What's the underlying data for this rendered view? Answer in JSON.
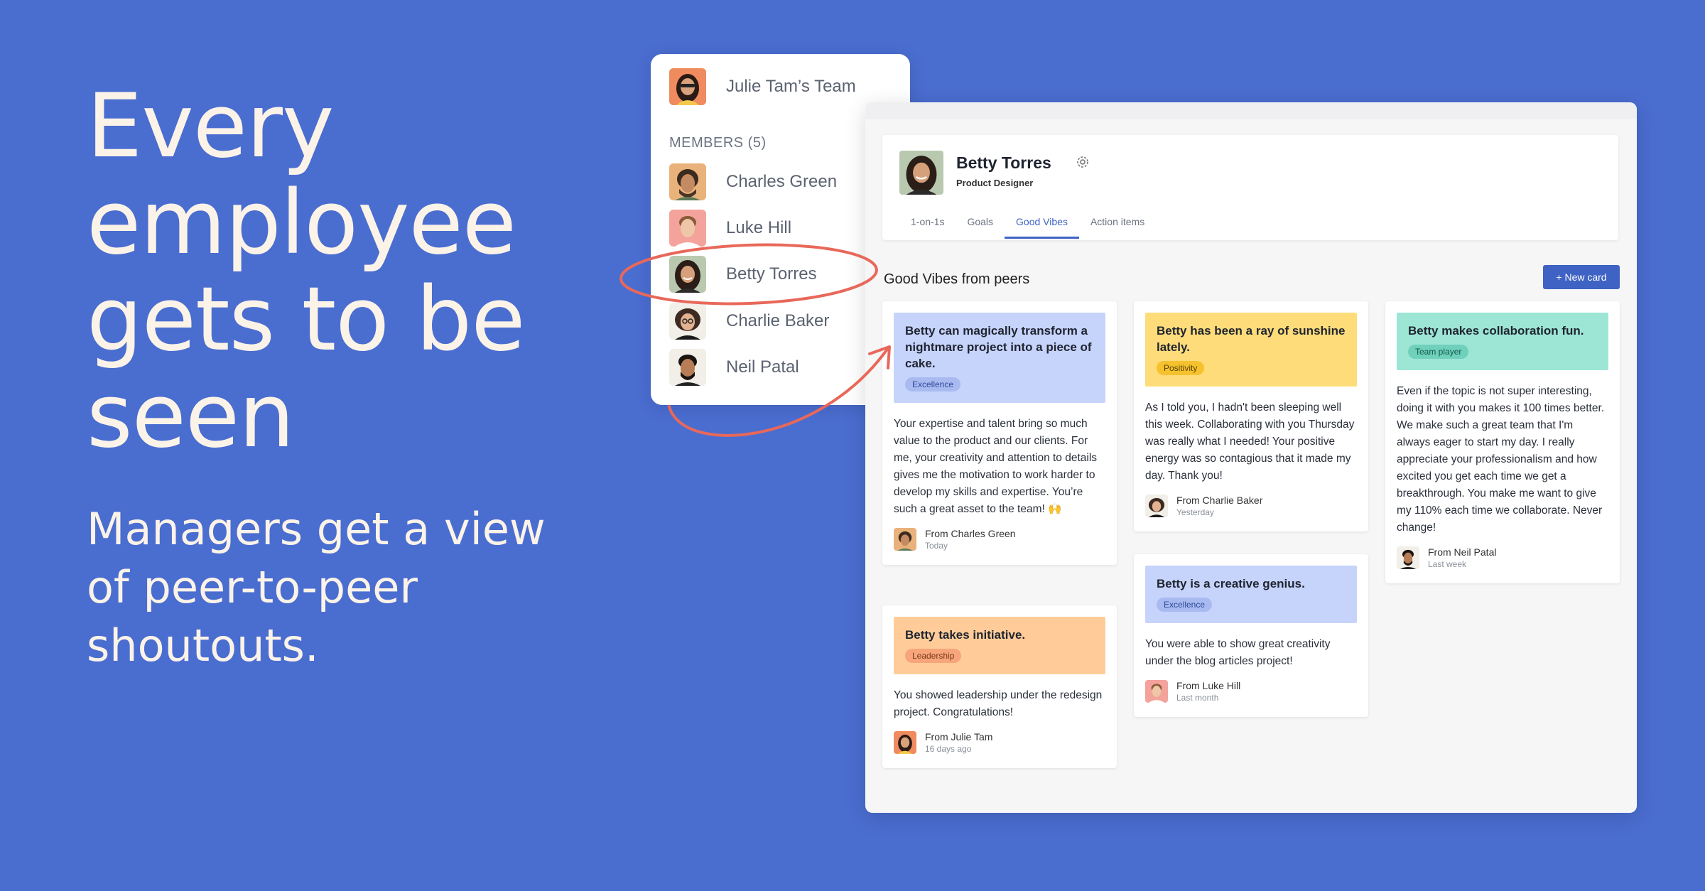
{
  "hero": {
    "headline": "Every employee gets to be seen",
    "subheadline": "Managers get a view of peer-to-peer shoutouts."
  },
  "team": {
    "title": "Julie Tam’s Team",
    "members_label": "MEMBERS (5)",
    "members": [
      {
        "name": "Charles Green"
      },
      {
        "name": "Luke Hill"
      },
      {
        "name": "Betty Torres"
      },
      {
        "name": "Charlie Baker"
      },
      {
        "name": "Neil Patal"
      }
    ]
  },
  "profile": {
    "name": "Betty Torres",
    "role": "Product Designer",
    "tabs": [
      "1-on-1s",
      "Goals",
      "Good Vibes",
      "Action items"
    ],
    "active_tab": "Good Vibes"
  },
  "vibes": {
    "section_title": "Good Vibes from peers",
    "new_card_label": "+ New card",
    "cards": [
      {
        "title": "Betty can magically transform a nightmare project into a piece of cake.",
        "tag": "Excellence",
        "body": "Your expertise and talent bring so much value to the product and our clients. For me, your creativity and attention to details gives me the motivation to work harder to develop my skills and expertise. You’re such a great asset to the team! 🙌",
        "from": "From Charles Green",
        "when": "Today"
      },
      {
        "title": "Betty takes initiative.",
        "tag": "Leadership",
        "body": "You showed leadership under the redesign project. Congratulations!",
        "from": "From Julie Tam",
        "when": "16 days ago"
      },
      {
        "title": "Betty has been a ray of sunshine lately.",
        "tag": "Positivity",
        "body": "As I told you, I hadn't been sleeping well this week. Collaborating with you Thursday was really what I needed! Your positive energy was so contagious that it made my day. Thank you!",
        "from": "From Charlie Baker",
        "when": "Yesterday"
      },
      {
        "title": "Betty is a creative genius.",
        "tag": "Excellence",
        "body": "You were able to show great creativity under the blog articles project!",
        "from": "From Luke Hill",
        "when": "Last month"
      },
      {
        "title": "Betty makes collaboration fun.",
        "tag": "Team player",
        "body": "Even if the topic is not super interesting, doing it with you makes it 100 times better. We make such a great team that I'm always eager to start my day. I really appreciate your professionalism and how excited you get each time we get a breakthrough. You make me want to give my 110% each time we collaborate. Never change!",
        "from": "From Neil Patal",
        "when": "Last week"
      }
    ]
  },
  "colors": {
    "background": "#4a6dd0",
    "accent": "#3f63c4",
    "annotation": "#e8685a",
    "excellence": "#c6d3fb",
    "leadership": "#ffcc99",
    "positivity": "#ffdc7a",
    "team_player": "#9de6d5"
  }
}
